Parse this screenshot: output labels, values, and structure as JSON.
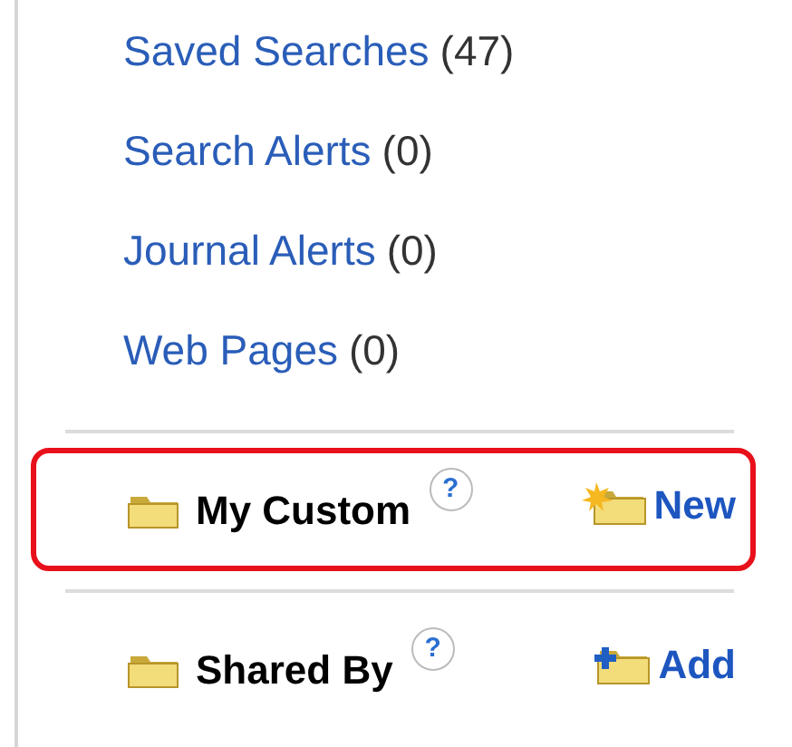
{
  "links": [
    {
      "label": "Saved Searches",
      "count": "(47)"
    },
    {
      "label": "Search Alerts",
      "count": "(0)"
    },
    {
      "label": "Journal Alerts",
      "count": "(0)"
    },
    {
      "label": "Web Pages",
      "count": "(0)"
    }
  ],
  "folders": [
    {
      "title": "My Custom",
      "help": "?",
      "action": {
        "kind": "new",
        "label": "New"
      },
      "highlighted": true
    },
    {
      "title": "Shared By",
      "help": "?",
      "action": {
        "kind": "add",
        "label": "Add"
      },
      "highlighted": false
    }
  ]
}
